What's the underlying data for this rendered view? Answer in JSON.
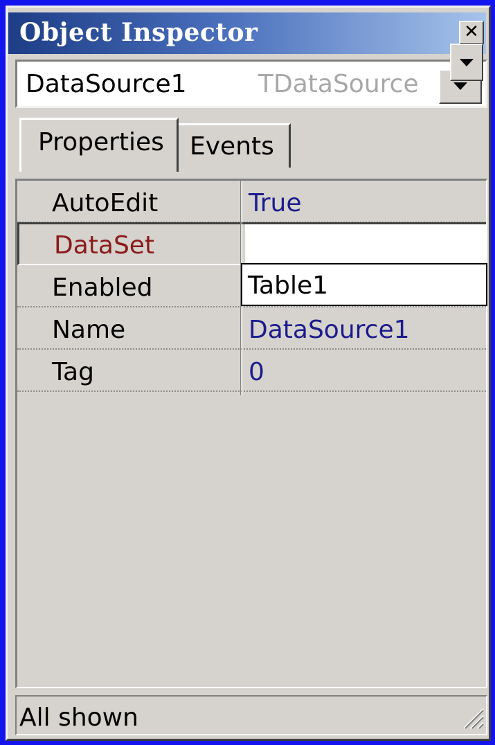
{
  "window": {
    "title": "Object Inspector",
    "close_glyph": "✕"
  },
  "object_selector": {
    "name": "DataSource1",
    "type": "TDataSource"
  },
  "tabs": [
    {
      "label": "Properties",
      "active": true
    },
    {
      "label": "Events",
      "active": false
    }
  ],
  "properties": [
    {
      "name": "AutoEdit",
      "value": "True"
    },
    {
      "name": "DataSet",
      "value": ""
    },
    {
      "name": "Enabled",
      "value": ""
    },
    {
      "name": "Name",
      "value": "DataSource1"
    },
    {
      "name": "Tag",
      "value": "0"
    }
  ],
  "dataset_dropdown": {
    "options": [
      "Table1"
    ]
  },
  "status": {
    "text": "All shown"
  },
  "colors": {
    "background": "#1414ee",
    "panel": "#d6d3ce",
    "title_gradient_start": "#1d3d86",
    "title_gradient_end": "#a6c3ea",
    "value_text": "#1c1c8c",
    "selected_name_text": "#8b1a1a"
  },
  "icons": {
    "close": "close-icon",
    "dropdown": "chevron-down-icon",
    "resize": "resize-grip-icon"
  }
}
